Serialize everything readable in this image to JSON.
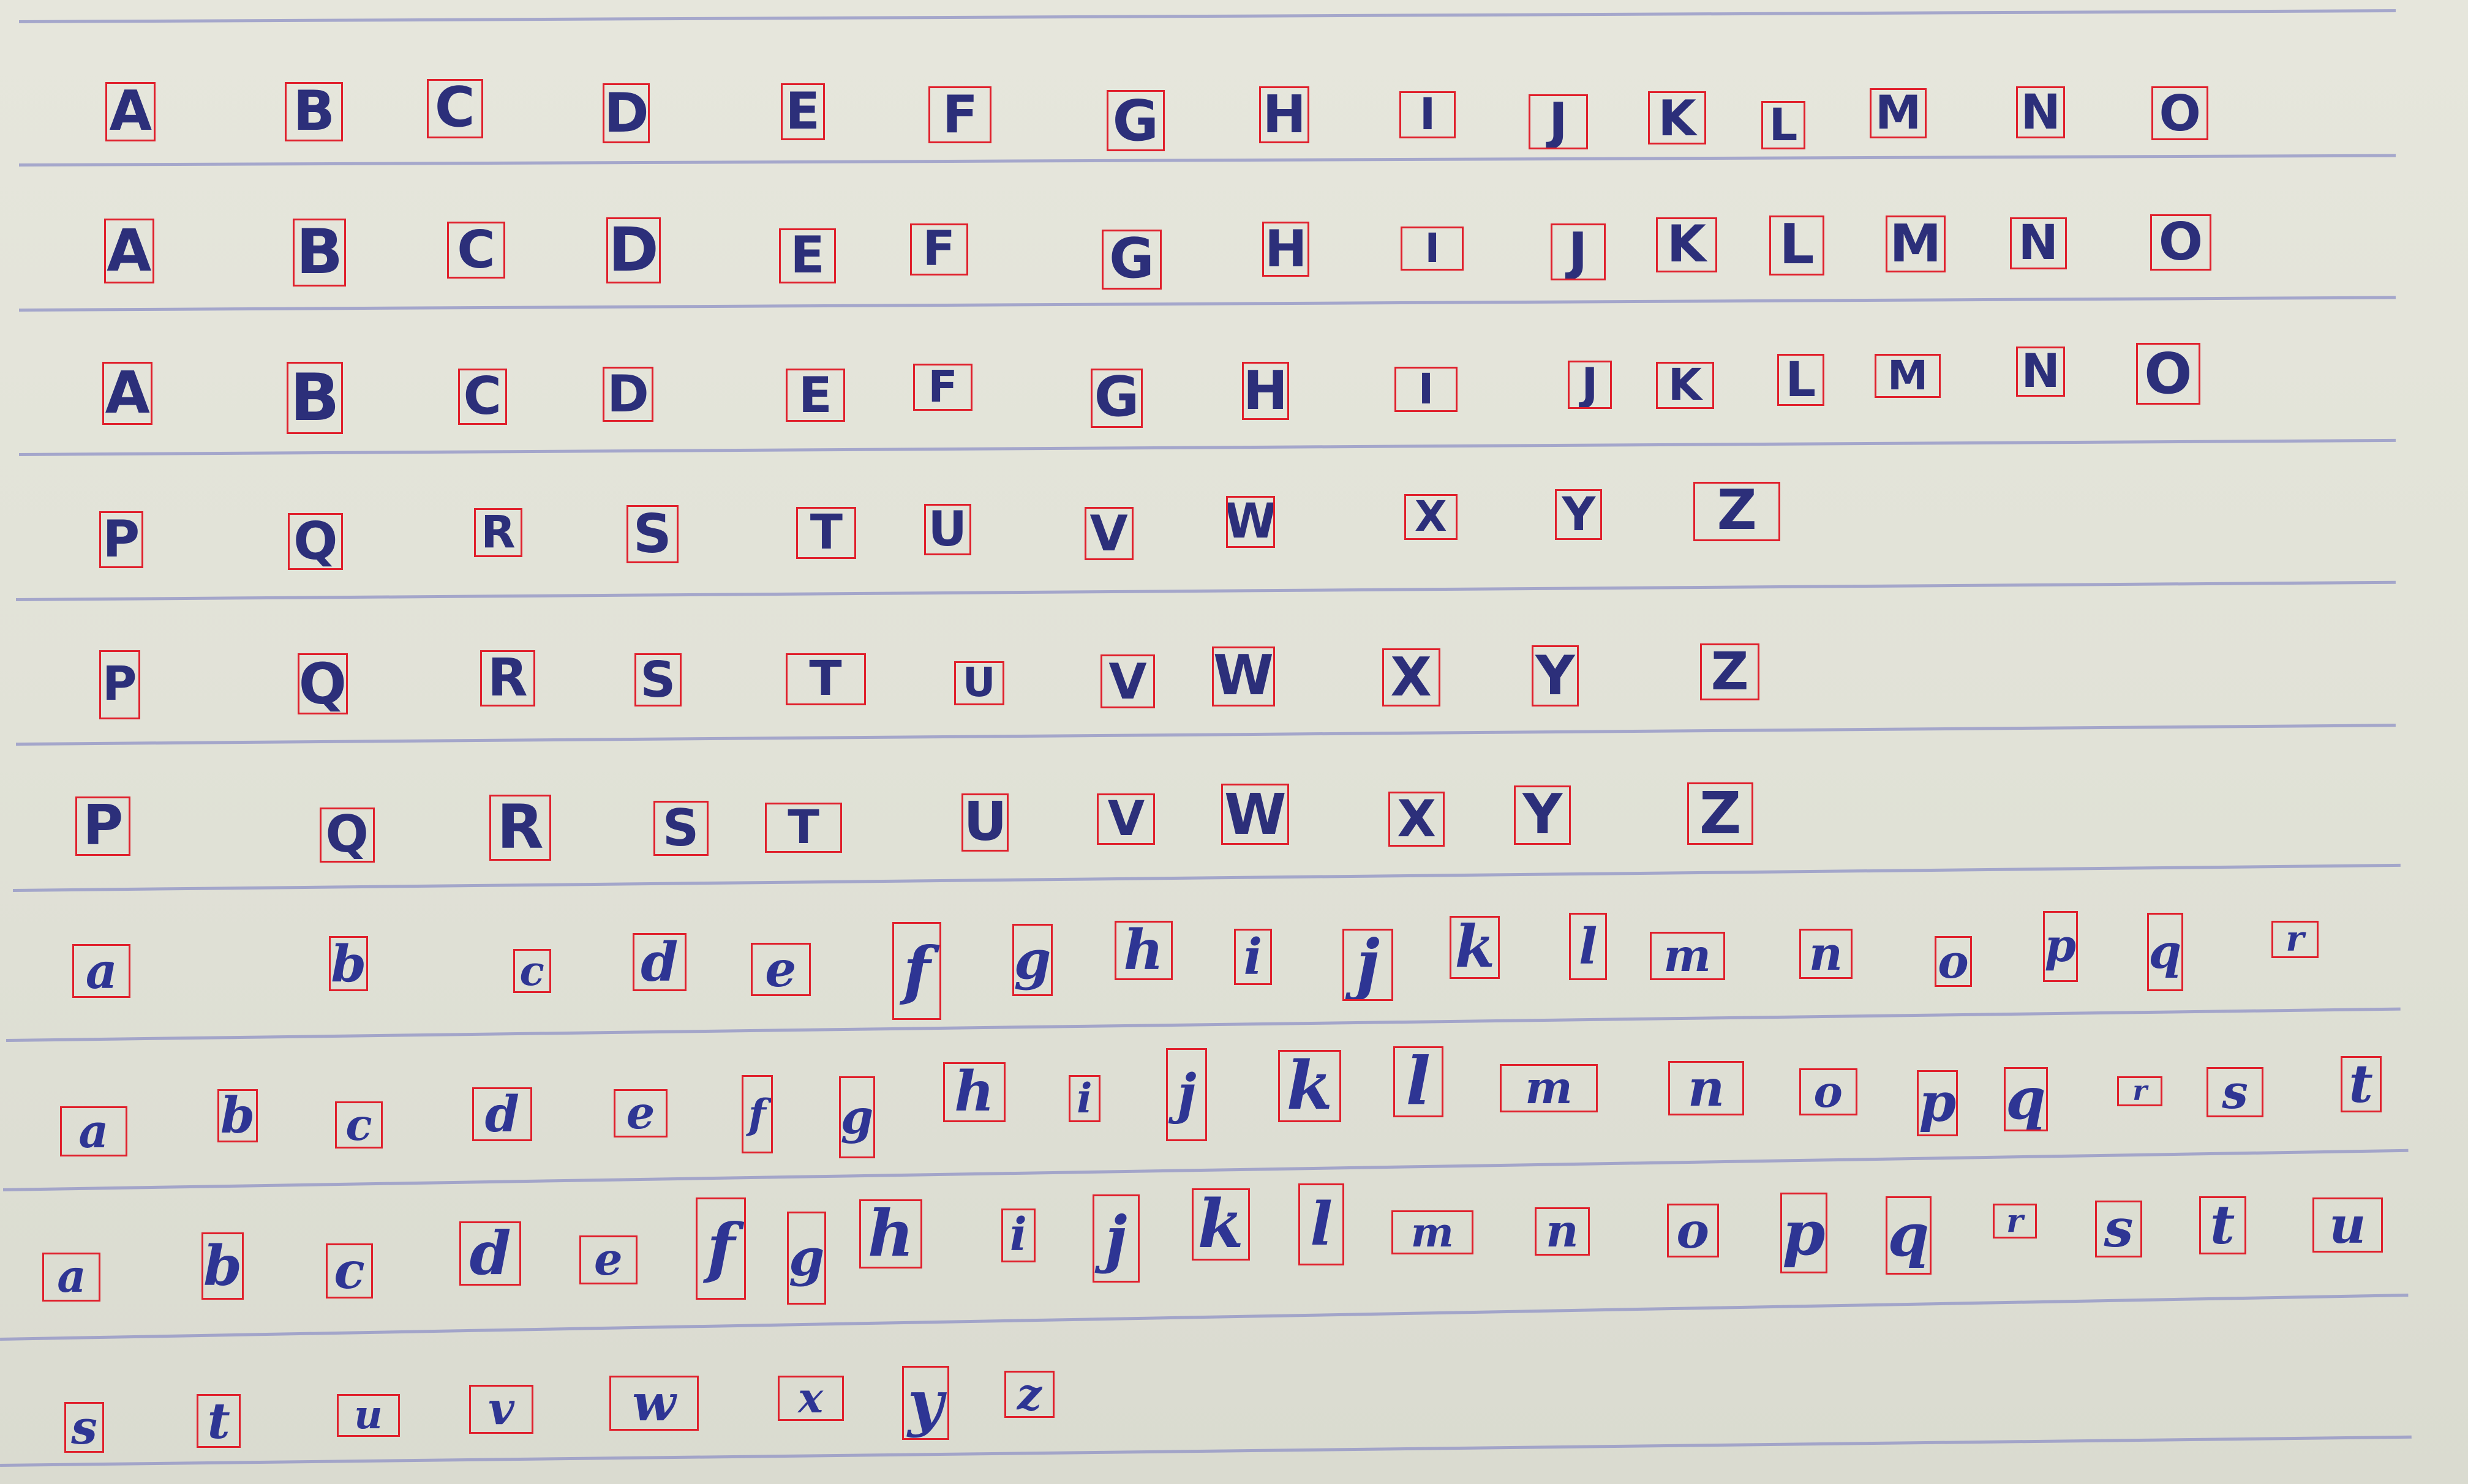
{
  "sheet": {
    "rows": [
      {
        "kind": "upper",
        "letters": [
          "A",
          "B",
          "C",
          "D",
          "E",
          "F",
          "G",
          "H",
          "I",
          "J",
          "K",
          "L",
          "M",
          "N",
          "O"
        ]
      },
      {
        "kind": "upper",
        "letters": [
          "A",
          "B",
          "C",
          "D",
          "E",
          "F",
          "G",
          "H",
          "I",
          "J",
          "K",
          "L",
          "M",
          "N",
          "O"
        ]
      },
      {
        "kind": "upper",
        "letters": [
          "A",
          "B",
          "C",
          "D",
          "E",
          "F",
          "G",
          "H",
          "I",
          "J",
          "K",
          "L",
          "M",
          "N",
          "O"
        ]
      },
      {
        "kind": "upper",
        "letters": [
          "P",
          "Q",
          "R",
          "S",
          "T",
          "U",
          "V",
          "W",
          "X",
          "Y",
          "Z"
        ]
      },
      {
        "kind": "upper",
        "letters": [
          "P",
          "Q",
          "R",
          "S",
          "T",
          "U",
          "V",
          "W",
          "X",
          "Y",
          "Z"
        ]
      },
      {
        "kind": "upper",
        "letters": [
          "P",
          "Q",
          "R",
          "S",
          "T",
          "U",
          "V",
          "W",
          "X",
          "Y",
          "Z"
        ]
      },
      {
        "kind": "lower",
        "letters": [
          "a",
          "b",
          "c",
          "d",
          "e",
          "f",
          "g",
          "h",
          "i",
          "j",
          "k",
          "l",
          "m",
          "n",
          "o",
          "p",
          "q",
          "r"
        ]
      },
      {
        "kind": "lower",
        "letters": [
          "a",
          "b",
          "c",
          "d",
          "e",
          "f",
          "g",
          "h",
          "i",
          "j",
          "k",
          "l",
          "m",
          "n",
          "o",
          "p",
          "q",
          "r",
          "s",
          "t"
        ]
      },
      {
        "kind": "lower",
        "letters": [
          "a",
          "b",
          "c",
          "d",
          "e",
          "f",
          "g",
          "h",
          "i",
          "j",
          "k",
          "l",
          "m",
          "n",
          "o",
          "p",
          "q",
          "r",
          "s",
          "t",
          "u"
        ]
      },
      {
        "kind": "lower",
        "letters": [
          "s",
          "t",
          "u",
          "v",
          "w",
          "x",
          "y",
          "z"
        ]
      }
    ]
  },
  "colors": {
    "paper": "#e3e4d9",
    "rule_line": "#8f92c6",
    "ink": "#2e3594",
    "annotation_box": "#e0202c"
  }
}
